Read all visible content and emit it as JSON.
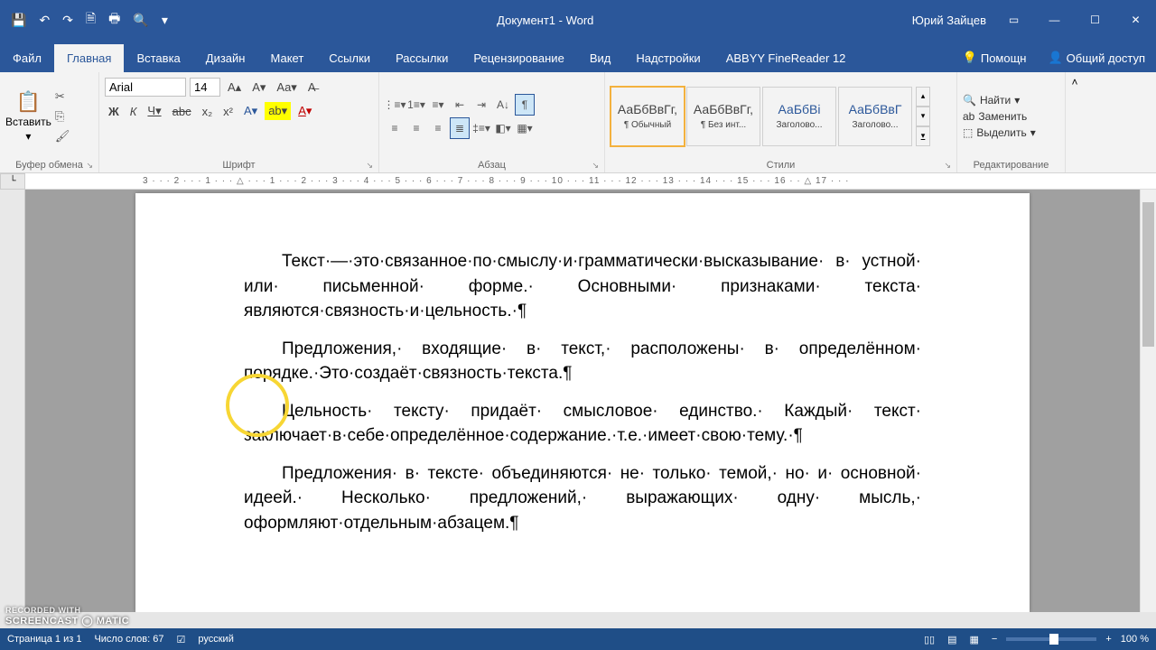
{
  "title": "Документ1 - Word",
  "user": "Юрий Зайцев",
  "qat": [
    "💾",
    "↶",
    "↷",
    "🗎",
    "🖶",
    "🔍",
    "▾"
  ],
  "tabs": [
    "Файл",
    "Главная",
    "Вставка",
    "Дизайн",
    "Макет",
    "Ссылки",
    "Рассылки",
    "Рецензирование",
    "Вид",
    "Надстройки",
    "ABBYY FineReader 12"
  ],
  "active_tab": 1,
  "help": "Помощн",
  "share": "Общий доступ",
  "clipboard": {
    "paste": "Вставить",
    "label": "Буфер обмена"
  },
  "font": {
    "name": "Arial",
    "size": "14",
    "label": "Шрифт"
  },
  "paragraph_label": "Абзац",
  "styles_label": "Стили",
  "styles": [
    {
      "preview": "АаБбВвГг,",
      "name": "¶ Обычный",
      "blue": false,
      "sel": true
    },
    {
      "preview": "АаБбВвГг,",
      "name": "¶ Без инт...",
      "blue": false,
      "sel": false
    },
    {
      "preview": "АаБбВі",
      "name": "Заголово...",
      "blue": true,
      "sel": false
    },
    {
      "preview": "АаБбВвГ",
      "name": "Заголово...",
      "blue": true,
      "sel": false
    }
  ],
  "editing": {
    "find": "Найти",
    "replace": "Заменить",
    "select": "Выделить",
    "label": "Редактирование"
  },
  "ruler_marks": "3 · · · 2 · · · 1 · · ·  △ · · · 1 · · · 2 · · · 3 · · · 4 · · · 5 · · · 6 · · · 7 · · · 8 · · · 9 · · · 10 · · · 11 · · · 12 · · · 13 · · · 14 · · · 15 · · · 16 · · △ 17 · · ·",
  "ruler_corner": "└",
  "doc": {
    "p1": "Текст·—·это·связанное·по·смыслу·и·грамматически·высказывание· в· устной· или· письменной· форме.· Основными· признаками· текста· являются·связность·и·цельность.·",
    "p2": "Предложения,· входящие· в· текст,· расположены· в· определённом· порядке.·Это·создаёт·связность·текста.",
    "p3": "Цельность· тексту· придаёт· смысловое· единство.· Каждый· текст· заключает·в·себе·определённое·содержание.·т.е.·имеет·свою·тему.·",
    "p4": "Предложения· в· тексте· объединяются· не· только· темой,· но· и· основной· идеей.· Несколько· предложений,· выражающих· одну· мысль,· оформляют·отдельным·абзацем."
  },
  "status": {
    "page": "Страница 1 из 1",
    "words": "Число слов: 67",
    "lang": "русский",
    "zoom": "100 %"
  },
  "watermark": {
    "top": "RECORDED WITH",
    "brand": "SCREENCAST ◯ MATIC"
  }
}
